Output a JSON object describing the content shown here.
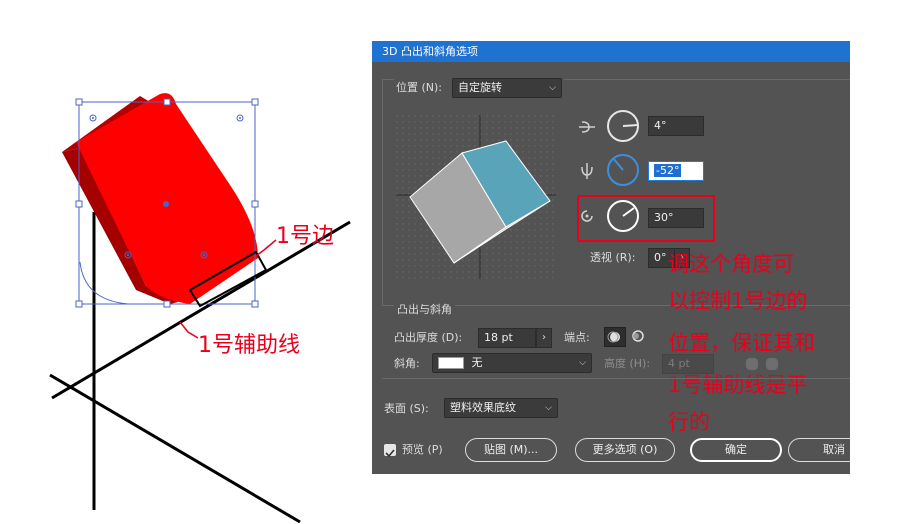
{
  "artwork": {
    "edge_label": "1号边",
    "guide_label": "1号辅助线"
  },
  "dialog": {
    "title": "3D 凸出和斜角选项",
    "position_label": "位置 (N):",
    "position_value": "自定旋转",
    "rotation_x": "4°",
    "rotation_y": "-52°",
    "rotation_z": "30°",
    "perspective_label": "透视 (R):",
    "perspective_value": "0°",
    "extrude_section_label": "凸出与斜角",
    "extrude_depth_label": "凸出厚度 (D):",
    "extrude_depth_value": "18 pt",
    "cap_label": "端点:",
    "bevel_label": "斜角:",
    "bevel_value": "无",
    "height_label": "高度 (H):",
    "height_value": "4 pt",
    "surface_label": "表面 (S):",
    "surface_value": "塑料效果底纹",
    "preview_label": "预览 (P)",
    "map_button": "贴图 (M)...",
    "more_options_button": "更多选项 (O)",
    "ok_button": "确定",
    "cancel_button": "取消"
  },
  "annotation": {
    "lines": [
      "调这个角度可",
      "以控制1号边的",
      "位置，保证其和",
      "1号辅助线是平",
      "行的"
    ]
  },
  "colors": {
    "highlight_red": "#e8001c",
    "object_red": "#ff0000",
    "dialog_bg": "#535353",
    "titlebar": "#1f72cf",
    "cube_front": "#a7a7a7",
    "cube_side": "#5aa4ba"
  }
}
